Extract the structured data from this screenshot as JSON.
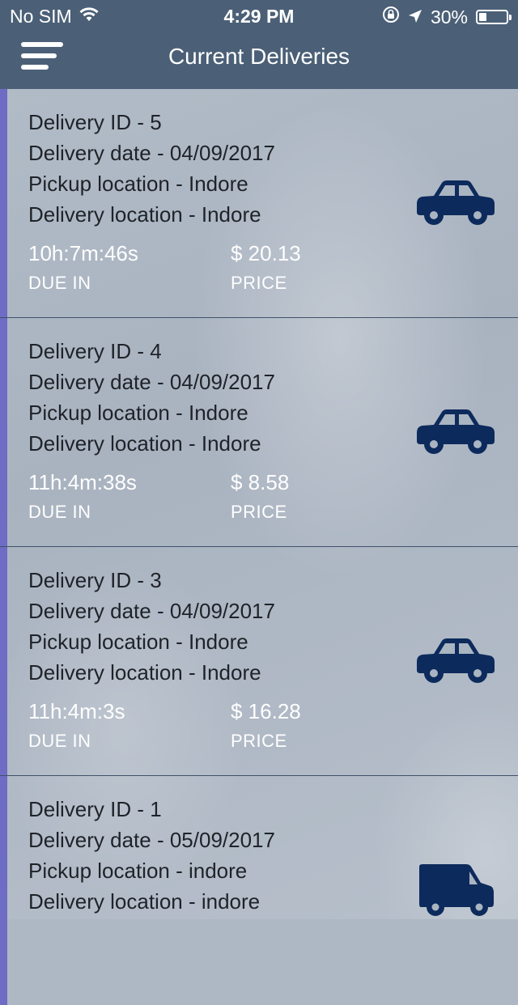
{
  "status_bar": {
    "carrier": "No SIM",
    "time": "4:29 PM",
    "battery": "30%",
    "icons": [
      "wifi-icon",
      "orientation-lock-icon",
      "location-arrow-icon",
      "battery-icon"
    ]
  },
  "nav": {
    "title": "Current Deliveries",
    "menu_icon": "hamburger-menu-icon"
  },
  "colors": {
    "header": "#4b6077",
    "accent": "#6e6cc4",
    "icon": "#0d2a5c"
  },
  "deliveries": [
    {
      "id_line": "Delivery ID - 5",
      "date_line": "Delivery date - 04/09/2017",
      "pickup_line": "Pickup location - Indore",
      "delivery_line": "Delivery location - Indore",
      "due": "10h:7m:46s",
      "due_label": "DUE IN",
      "price": "$ 20.13",
      "price_label": "PRICE",
      "vehicle": "car-icon"
    },
    {
      "id_line": "Delivery ID - 4",
      "date_line": "Delivery date - 04/09/2017",
      "pickup_line": "Pickup location - Indore",
      "delivery_line": "Delivery location - Indore",
      "due": "11h:4m:38s",
      "due_label": "DUE IN",
      "price": "$ 8.58",
      "price_label": "PRICE",
      "vehicle": "car-icon"
    },
    {
      "id_line": "Delivery ID - 3",
      "date_line": "Delivery date - 04/09/2017",
      "pickup_line": "Pickup location - Indore",
      "delivery_line": "Delivery location - Indore",
      "due": "11h:4m:3s",
      "due_label": "DUE IN",
      "price": "$ 16.28",
      "price_label": "PRICE",
      "vehicle": "car-icon"
    },
    {
      "id_line": "Delivery ID - 1",
      "date_line": "Delivery date - 05/09/2017",
      "pickup_line": "Pickup location - indore",
      "delivery_line": "Delivery location - indore",
      "due": "",
      "due_label": "",
      "price": "",
      "price_label": "",
      "vehicle": "van-icon"
    }
  ]
}
